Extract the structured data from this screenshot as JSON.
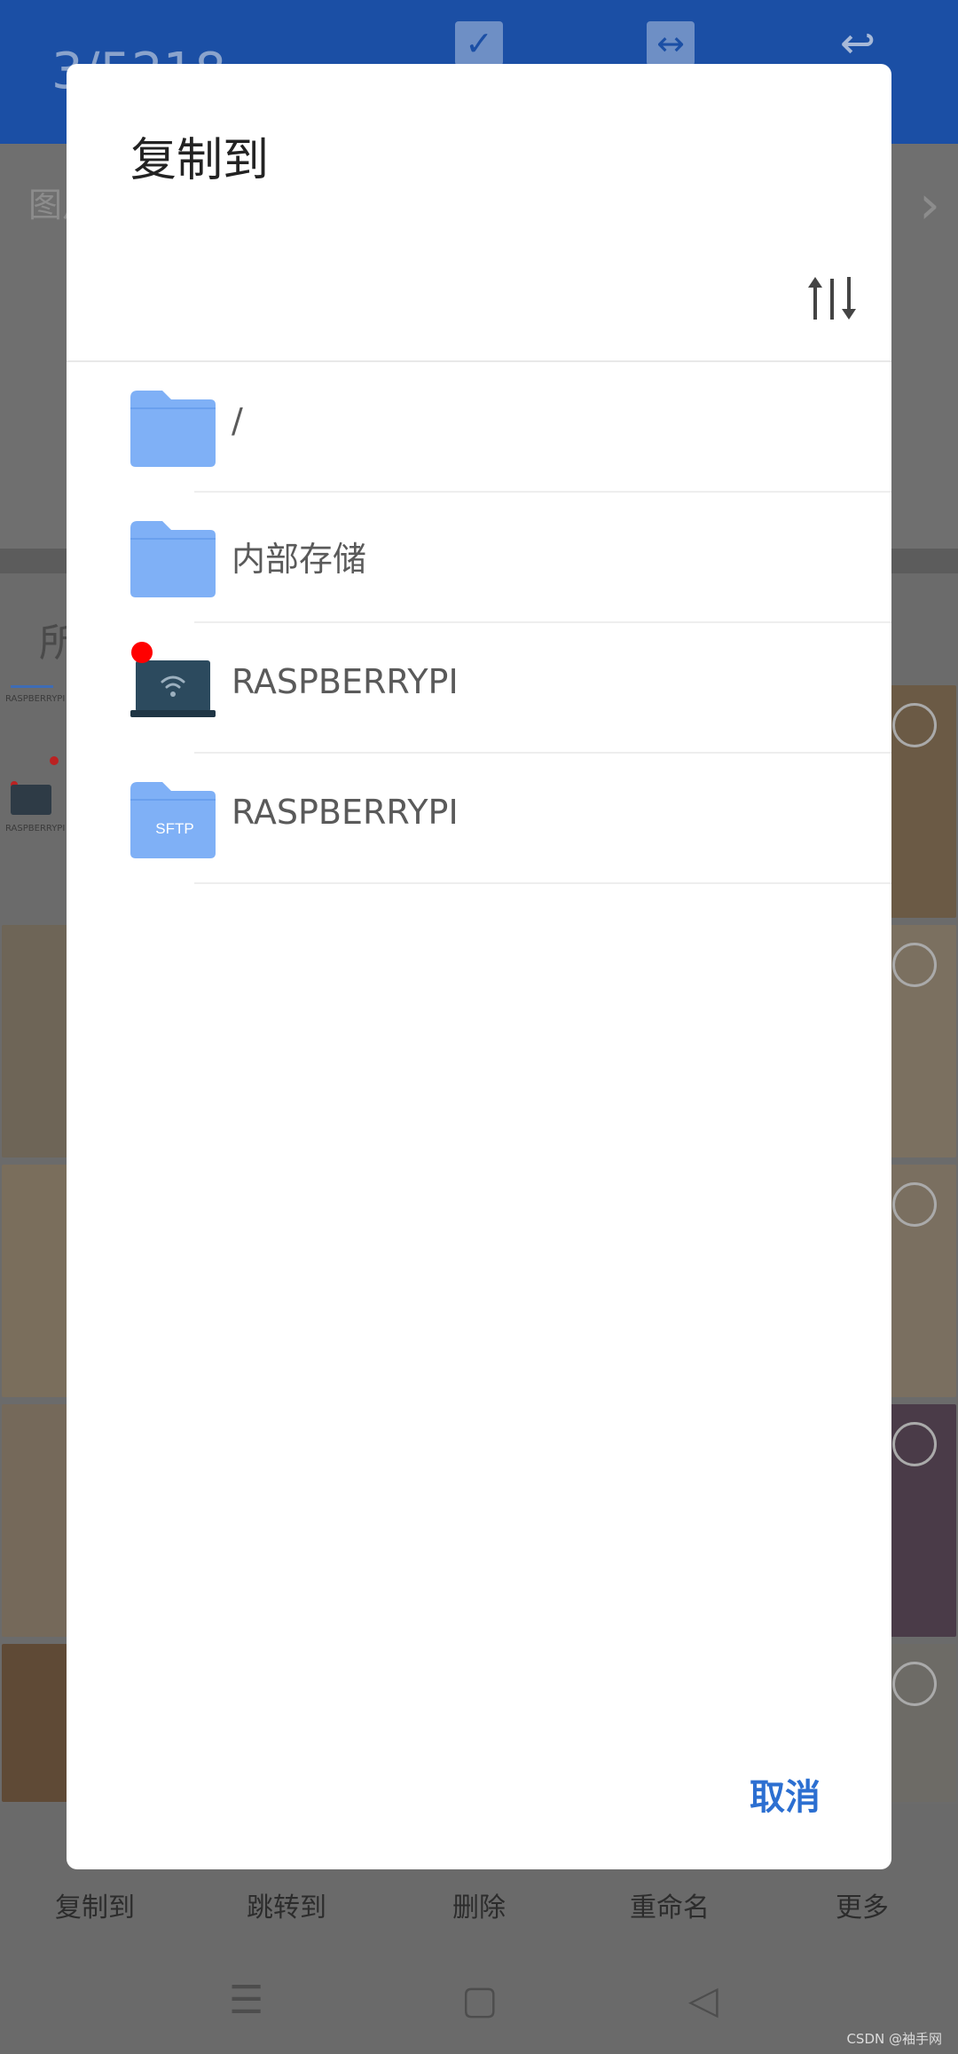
{
  "background": {
    "counter": "3/5218",
    "path_text": "图片",
    "all_title": "所",
    "mini_label_top": "RASPBERRYPI",
    "mini_label_bottom": "RASPBERRYPI",
    "actions": [
      "复制到",
      "跳转到",
      "删除",
      "重命名",
      "更多"
    ],
    "watermark": "CSDN @袖手网"
  },
  "dialog": {
    "title": "复制到",
    "items": [
      {
        "label": "/",
        "icon": "folder-icon"
      },
      {
        "label": "内部存储",
        "icon": "folder-icon"
      },
      {
        "label": "RASPBERRYPI",
        "icon": "laptop-wifi-icon",
        "badge": "red-dot"
      },
      {
        "label": "RASPBERRYPI",
        "icon": "sftp-folder-icon",
        "icon_text": "SFTP"
      }
    ],
    "cancel_label": "取消"
  },
  "colors": {
    "accent": "#2c6fd1",
    "folder": "#7fb0f6",
    "header": "#1b4fa5",
    "badge": "#ff0000"
  }
}
